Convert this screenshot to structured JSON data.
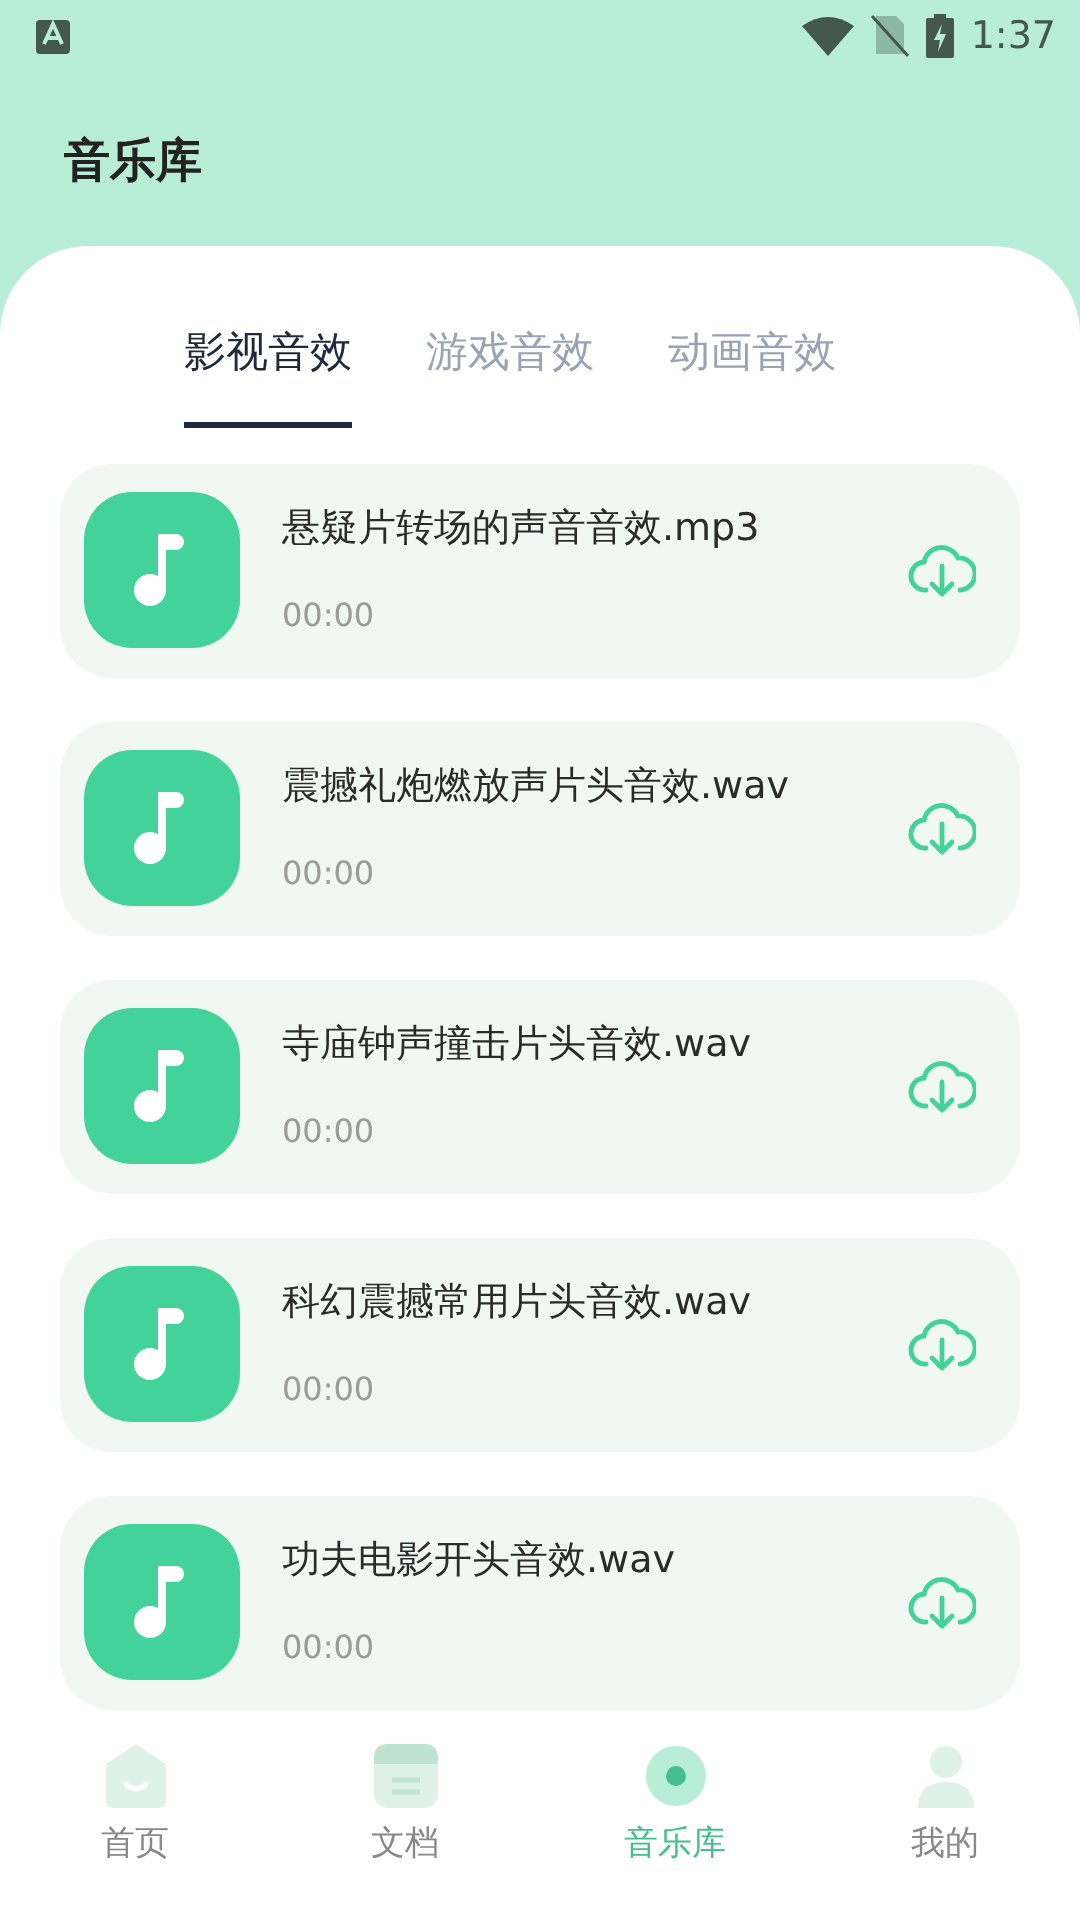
{
  "status_bar": {
    "time": "1:37"
  },
  "header": {
    "title": "音乐库"
  },
  "tabs": [
    {
      "label": "影视音效",
      "selected": true
    },
    {
      "label": "游戏音效",
      "selected": false
    },
    {
      "label": "动画音效",
      "selected": false
    }
  ],
  "tracks": [
    {
      "name": "悬疑片转场的声音音效.mp3",
      "duration": "00:00"
    },
    {
      "name": "震撼礼炮燃放声片头音效.wav",
      "duration": "00:00"
    },
    {
      "name": "寺庙钟声撞击片头音效.wav",
      "duration": "00:00"
    },
    {
      "name": "科幻震撼常用片头音效.wav",
      "duration": "00:00"
    },
    {
      "name": "功夫电影开头音效.wav",
      "duration": "00:00"
    }
  ],
  "bottom_nav": [
    {
      "kind": "home",
      "label": "首页",
      "selected": false
    },
    {
      "kind": "docs",
      "label": "文档",
      "selected": false
    },
    {
      "kind": "music",
      "label": "音乐库",
      "selected": true
    },
    {
      "kind": "profile",
      "label": "我的",
      "selected": false
    }
  ]
}
